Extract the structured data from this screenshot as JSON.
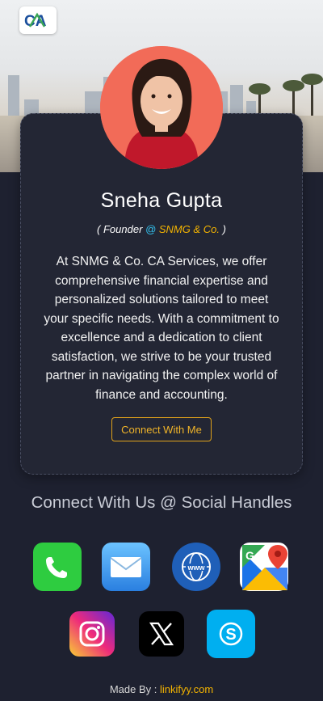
{
  "brand": {
    "logo_text": "CA"
  },
  "profile": {
    "name": "Sneha Gupta",
    "role_prefix": "( Founder ",
    "role_at": "@",
    "role_company": " SNMG & Co.",
    "role_suffix": " )",
    "bio": "At SNMG & Co. CA Services, we offer comprehensive financial expertise and personalized solutions tailored to meet your specific needs. With a commitment to excellence and a dedication to client satisfaction, we strive to be your trusted partner in navigating the complex world of finance and accounting.",
    "cta_label": "Connect With Me"
  },
  "social": {
    "title": "Connect With Us @ Social Handles",
    "items": [
      {
        "icon": "phone-icon",
        "color": "#2ecc40"
      },
      {
        "icon": "mail-icon",
        "color": "#4aa3f0"
      },
      {
        "icon": "website-icon",
        "color": "#1f5fb8"
      },
      {
        "icon": "maps-icon",
        "color": "#34a853"
      },
      {
        "icon": "instagram-icon",
        "color": "#d6249f"
      },
      {
        "icon": "x-icon",
        "color": "#000000"
      },
      {
        "icon": "skype-icon",
        "color": "#00aff0"
      }
    ]
  },
  "footer": {
    "made_by": "Made By : ",
    "link": "linkifyy.com"
  },
  "colors": {
    "background": "#1e2130",
    "card": "#232634",
    "accent": "#f4b400",
    "avatar_bg": "#f26b58"
  }
}
